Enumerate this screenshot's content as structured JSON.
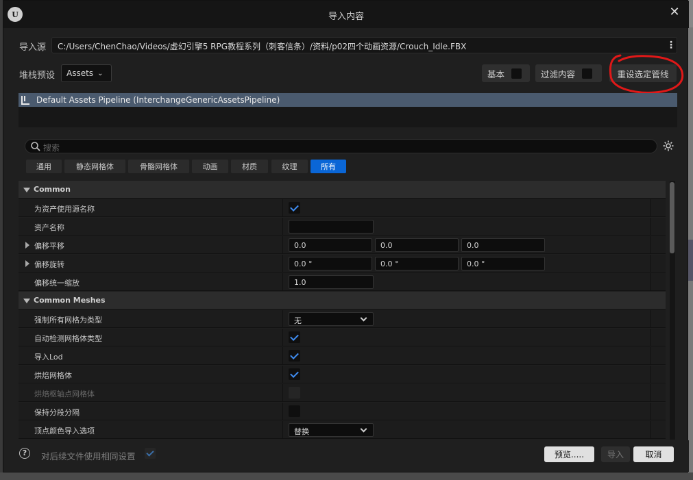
{
  "window": {
    "title": "导入内容"
  },
  "source": {
    "label": "导入源",
    "path": "C:/Users/ChenChao/Videos/虚幻引擎5 RPG教程系列（刺客信条）/资料/p02四个动画资源/Crouch_Idle.FBX"
  },
  "preset": {
    "label": "堆栈预设",
    "value": "Assets"
  },
  "toolbar": {
    "basic_label": "基本",
    "filter_label": "过滤内容",
    "reset_label": "重设选定管线"
  },
  "pipeline": {
    "name": "Default Assets Pipeline (InterchangeGenericAssetsPipeline)"
  },
  "search": {
    "placeholder": "搜索"
  },
  "categories": [
    {
      "label": "通用",
      "active": false
    },
    {
      "label": "静态网格体",
      "active": false
    },
    {
      "label": "骨骼网格体",
      "active": false
    },
    {
      "label": "动画",
      "active": false
    },
    {
      "label": "材质",
      "active": false
    },
    {
      "label": "纹理",
      "active": false
    },
    {
      "label": "所有",
      "active": true
    }
  ],
  "properties": [
    {
      "type": "category",
      "name": "Common"
    },
    {
      "type": "checkbox",
      "name": "为资产使用源名称",
      "checked": true
    },
    {
      "type": "text",
      "name": "资产名称",
      "value": ""
    },
    {
      "type": "vector",
      "name": "偏移平移",
      "values": [
        "0.0",
        "0.0",
        "0.0"
      ]
    },
    {
      "type": "vector",
      "name": "偏移旋转",
      "values": [
        "0.0 °",
        "0.0 °",
        "0.0 °"
      ]
    },
    {
      "type": "text",
      "name": "偏移统一缩放",
      "value": "1.0"
    },
    {
      "type": "category",
      "name": "Common Meshes"
    },
    {
      "type": "dropdown",
      "name": "强制所有网格为类型",
      "value": "无"
    },
    {
      "type": "checkbox",
      "name": "自动检测网格体类型",
      "checked": true
    },
    {
      "type": "checkbox",
      "name": "导入Lod",
      "checked": true
    },
    {
      "type": "checkbox",
      "name": "烘焙网格体",
      "checked": true
    },
    {
      "type": "checkbox",
      "name": "烘焙枢轴点网格体",
      "checked": false,
      "disabled": true
    },
    {
      "type": "checkbox",
      "name": "保持分段分隔",
      "checked": false
    },
    {
      "type": "dropdown",
      "name": "顶点颜色导入选项",
      "value": "替换"
    }
  ],
  "footer": {
    "same_settings_label": "对后续文件使用相同设置",
    "preview_label": "预览.....",
    "import_label": "导入",
    "cancel_label": "取消"
  },
  "colors": {
    "accent": "#0a66d6",
    "annotation": "#e01818"
  }
}
